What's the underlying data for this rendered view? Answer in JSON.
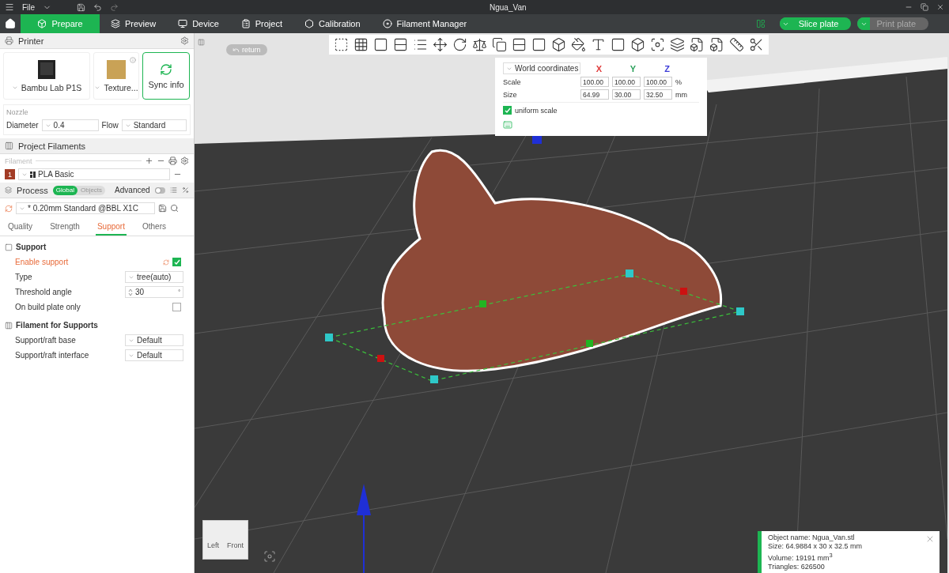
{
  "title_bar": {
    "menu": "File",
    "title": "Ngua_Van"
  },
  "nav_tabs": [
    {
      "label": "Prepare",
      "selected": true
    },
    {
      "label": "Preview",
      "selected": false
    },
    {
      "label": "Device",
      "selected": false
    },
    {
      "label": "Project",
      "selected": false
    },
    {
      "label": "Calibration",
      "selected": false
    },
    {
      "label": "Filament Manager",
      "selected": false
    }
  ],
  "actions": [
    {
      "label": "Slice plate",
      "disabled": false
    },
    {
      "label": "Print plate",
      "disabled": true
    }
  ],
  "printer": {
    "title": "Printer",
    "printer_name": "Bambu Lab P1S",
    "plate": "Texture...",
    "sync": "Sync info",
    "nozzle_label": "Nozzle",
    "diameter_label": "Diameter",
    "diameter": "0.4",
    "flow_label": "Flow",
    "flow": "Standard"
  },
  "filaments": {
    "title": "Project Filaments",
    "label": "Filament",
    "items": [
      {
        "index": "1",
        "name": "PLA Basic",
        "color": "#a23b25"
      }
    ]
  },
  "process": {
    "title": "Process",
    "scope": [
      {
        "label": "Global",
        "selected": true
      },
      {
        "label": "Objects",
        "selected": false
      }
    ],
    "advanced_label": "Advanced",
    "advanced": false,
    "preset": "* 0.20mm Standard @BBL X1C",
    "tabs": [
      {
        "label": "Quality",
        "selected": false
      },
      {
        "label": "Strength",
        "selected": false
      },
      {
        "label": "Support",
        "selected": true
      },
      {
        "label": "Others",
        "selected": false
      }
    ]
  },
  "groups": [
    {
      "title": "Support",
      "rows": [
        {
          "kind": "checkbox",
          "label": "Enable support",
          "checked": true,
          "modified": true
        },
        {
          "kind": "select",
          "label": "Type",
          "value": "tree(auto)"
        },
        {
          "kind": "spin",
          "label": "Threshold angle",
          "value": "30",
          "unit": "°"
        },
        {
          "kind": "checkbox",
          "label": "On build plate only",
          "checked": false,
          "modified": false
        }
      ]
    },
    {
      "title": "Filament for Supports",
      "rows": [
        {
          "kind": "select",
          "label": "Support/raft base",
          "value": "Default"
        },
        {
          "kind": "select",
          "label": "Support/raft interface",
          "value": "Default"
        }
      ]
    }
  ],
  "viewport": {
    "return_button": "return",
    "scale_panel": {
      "coordinate_system": "World coordinates",
      "axes": [
        {
          "label": "X",
          "color": "#e03c3c"
        },
        {
          "label": "Y",
          "color": "#2aa05a"
        },
        {
          "label": "Z",
          "color": "#3c3cd8"
        }
      ],
      "rows": [
        {
          "label": "Scale",
          "values": [
            "100.00",
            "100.00",
            "100.00"
          ],
          "unit": "%"
        },
        {
          "label": "Size",
          "values": [
            "64.99",
            "30.00",
            "32.50"
          ],
          "unit": "mm"
        }
      ],
      "uniform_scale_label": "uniform scale",
      "uniform_scale": true
    },
    "view_cube": {
      "left": "Left",
      "front": "Front"
    },
    "object_info": [
      "Object name: Ngua_Van.stl",
      "Size: 64.9884 x 30 x 32.5 mm",
      "Volume: 19191 mm$^{3}$",
      "Triangles: 626500"
    ]
  }
}
